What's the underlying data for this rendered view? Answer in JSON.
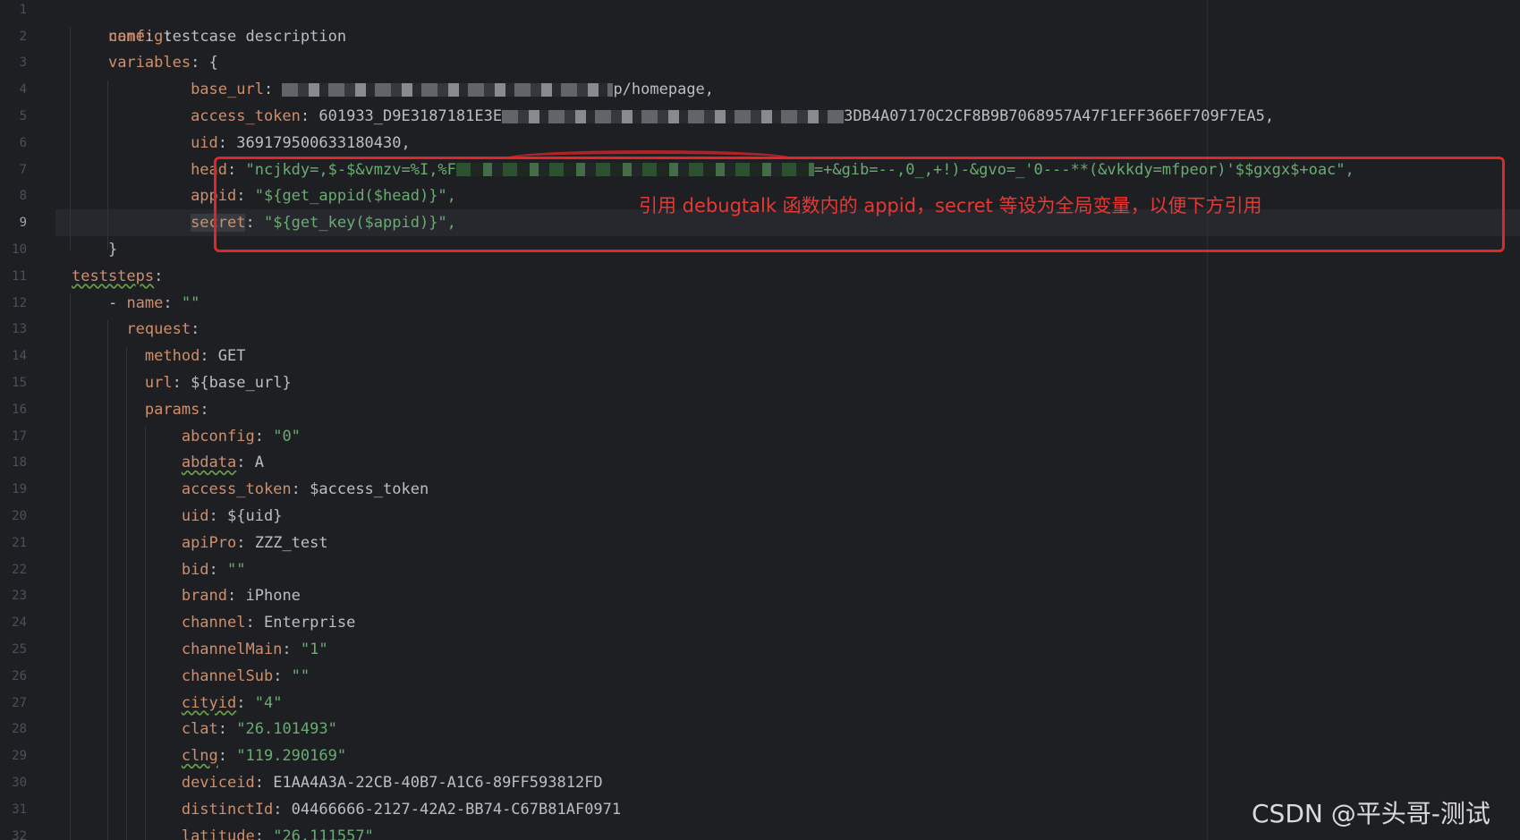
{
  "editor": {
    "current_line": 9,
    "lines": [
      {
        "n": "1"
      },
      {
        "n": "2"
      },
      {
        "n": "3"
      },
      {
        "n": "4"
      },
      {
        "n": "5"
      },
      {
        "n": "6"
      },
      {
        "n": "7"
      },
      {
        "n": "8"
      },
      {
        "n": "9"
      },
      {
        "n": "10"
      },
      {
        "n": "11"
      },
      {
        "n": "12"
      },
      {
        "n": "13"
      },
      {
        "n": "14"
      },
      {
        "n": "15"
      },
      {
        "n": "16"
      },
      {
        "n": "17"
      },
      {
        "n": "18"
      },
      {
        "n": "19"
      },
      {
        "n": "20"
      },
      {
        "n": "21"
      },
      {
        "n": "22"
      },
      {
        "n": "23"
      },
      {
        "n": "24"
      },
      {
        "n": "25"
      },
      {
        "n": "26"
      },
      {
        "n": "27"
      },
      {
        "n": "28"
      },
      {
        "n": "29"
      },
      {
        "n": "30"
      },
      {
        "n": "31"
      },
      {
        "n": "32"
      }
    ],
    "code": {
      "l1_key": "config",
      "l2_key": "name",
      "l2_val": "testcase description",
      "l3_key": "variables",
      "l3_val": "{",
      "l4_key": "base_url",
      "l4_val": "p/homepage,",
      "l5_key": "access_token",
      "l5_val_a": "601933_D9E3187181E3E",
      "l5_val_b": "3DB4A07170C2CF8B9B7068957A47F1EFF366EF709F7EA5,",
      "l6_key": "uid",
      "l6_val": "369179500633180430,",
      "l7_key": "head",
      "l7_val_a": "\"ncjkdy=,$-$&vmzv=%I,%F",
      "l7_val_b": "=+&gib=--,0_,+!)-&gvo=_'0---**(&vkkdy=mfpeor)'$$gxgx$+oac\",",
      "l8_key": "appid",
      "l8_val": "\"${get_appid($head)}\",",
      "l9_key": "secret",
      "l9_val": "\"${get_key($appid)}\",",
      "l10_val": "}",
      "l11_key": "teststeps",
      "l12_dash": "- ",
      "l12_key": "name",
      "l12_val": "\"\"",
      "l13_key": "request",
      "l14_key": "method",
      "l14_val": "GET",
      "l15_key": "url",
      "l15_val": "${base_url}",
      "l16_key": "params",
      "l17_key": "abconfig",
      "l17_val": "\"0\"",
      "l18_key": "abdata",
      "l18_val": "A",
      "l19_key": "access_token",
      "l19_val": "$access_token",
      "l20_key": "uid",
      "l20_val": "${uid}",
      "l21_key": "apiPro",
      "l21_val": "ZZZ_test",
      "l22_key": "bid",
      "l22_val": "\"\"",
      "l23_key": "brand",
      "l23_val": "iPhone",
      "l24_key": "channel",
      "l24_val": "Enterprise",
      "l25_key": "channelMain",
      "l25_val": "\"1\"",
      "l26_key": "channelSub",
      "l26_val": "\"\"",
      "l27_key": "cityid",
      "l27_val": "\"4\"",
      "l28_key": "clat",
      "l28_val": "\"26.101493\"",
      "l29_key": "clng",
      "l29_val": "\"119.290169\"",
      "l30_key": "deviceid",
      "l30_val": "E1AA4A3A-22CB-40B7-A1C6-89FF593812FD",
      "l31_key": "distinctId",
      "l31_val": "04466666-2127-42A2-BB74-C67B81AF0971",
      "l32_key": "latitude",
      "l32_val": "\"26.111557\""
    }
  },
  "annotation": {
    "text": "引用 debugtalk 函数内的 appid，secret 等设为全局变量，以便下方引用",
    "color": "#e0262b"
  },
  "watermark": {
    "text": "CSDN @平头哥-测试"
  },
  "colors": {
    "background": "#1e1f22",
    "key": "#cf8e6d",
    "string": "#6aab73",
    "plain": "#bcbec4",
    "line_number": "#4b5059"
  }
}
